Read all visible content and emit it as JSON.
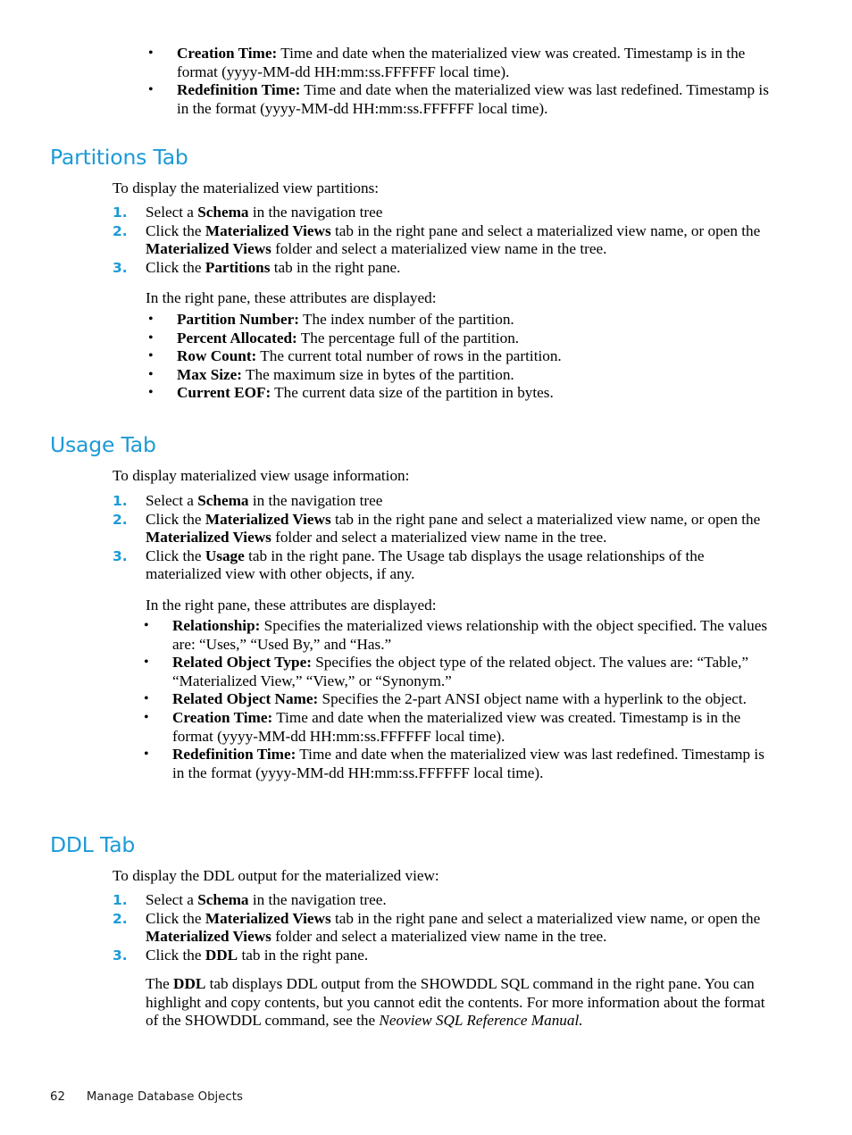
{
  "page": {
    "footer_page_number": "62",
    "footer_chapter": "Manage Database Objects",
    "heading_color": "#1c9ad6",
    "body_color": "#000000"
  },
  "top_bullets": [
    {
      "term": "Creation Time:",
      "text": " Time and date when the materialized view was created. Timestamp is in the format (yyyy-MM-dd HH:mm:ss.FFFFFF local time)."
    },
    {
      "term": "Redefinition Time:",
      "text": " Time and date when the materialized view was last redefined. Timestamp is in the format (yyyy-MM-dd HH:mm:ss.FFFFFF local time)."
    }
  ],
  "partitions_section": {
    "heading": "Partitions Tab",
    "intro": "To display the materialized view partitions:",
    "steps": [
      {
        "marker": "1.",
        "html": "Select a <b>Schema</b> in the navigation tree"
      },
      {
        "marker": "2.",
        "html": "Click the <b>Materialized Views</b> tab in the right pane and select a materialized view name, or open the <b>Materialized Views</b> folder and select a materialized view name in the tree."
      },
      {
        "marker": "3.",
        "html": "Click the <b>Partitions</b> tab in the right pane."
      }
    ],
    "attributes_intro": "In the right pane, these attributes are displayed:",
    "attributes": [
      {
        "term": "Partition Number:",
        "text": " The index number of the partition."
      },
      {
        "term": "Percent Allocated:",
        "text": " The percentage full of the partition."
      },
      {
        "term": "Row Count:",
        "text": " The current total number of rows in the partition."
      },
      {
        "term": "Max Size:",
        "text": " The maximum size in bytes of the partition."
      },
      {
        "term": "Current EOF:",
        "text": " The current data size of the partition in bytes."
      }
    ]
  },
  "usage_section": {
    "heading": "Usage Tab",
    "intro": "To display materialized view usage information:",
    "steps": [
      {
        "marker": "1.",
        "html": "Select a <b>Schema</b> in the navigation tree"
      },
      {
        "marker": "2.",
        "html": "Click the <b>Materialized Views</b> tab in the right pane and select a materialized view name, or open the <b>Materialized Views</b> folder and select a materialized view name in the tree."
      },
      {
        "marker": "3.",
        "html": "Click the <b>Usage</b> tab in the right pane. The Usage tab displays the usage relationships of the materialized view with other objects, if any."
      }
    ],
    "attributes_intro": "In the right pane, these attributes are displayed:",
    "attributes": [
      {
        "term": "Relationship:",
        "text": " Specifies the materialized views relationship with the object specified. The values are: “Uses,” “Used By,” and “Has.”"
      },
      {
        "term": "Related Object Type:",
        "text": " Specifies the object type of the related object. The values are: “Table,” “Materialized View,” “View,” or “Synonym.”"
      },
      {
        "term": "Related Object Name:",
        "text": " Specifies the 2-part ANSI object name with a hyperlink to the object."
      },
      {
        "term": "Creation Time:",
        "text": " Time and date when the materialized view was created. Timestamp is in the format (yyyy-MM-dd HH:mm:ss.FFFFFF local time)."
      },
      {
        "term": "Redefinition Time:",
        "text": " Time and date when the materialized view was last redefined. Timestamp is in the format (yyyy-MM-dd HH:mm:ss.FFFFFF local time)."
      }
    ]
  },
  "ddl_section": {
    "heading": "DDL Tab",
    "intro": "To display the DDL output for the materialized view:",
    "steps": [
      {
        "marker": "1.",
        "html": "Select a <b>Schema</b> in the navigation tree."
      },
      {
        "marker": "2.",
        "html": "Click the <b>Materialized Views</b> tab in the right pane and select a materialized view name, or open the <b>Materialized Views</b> folder and select a materialized view name in the tree."
      },
      {
        "marker": "3.",
        "html": "Click the <b>DDL</b> tab in the right pane."
      }
    ],
    "closing_html": "The <b>DDL</b> tab displays DDL output from the SHOWDDL SQL command in the right pane. You can highlight and copy contents, but you cannot edit the contents. For more information about the format of the SHOWDDL command, see the <i>Neoview SQL Reference Manual.</i>"
  }
}
